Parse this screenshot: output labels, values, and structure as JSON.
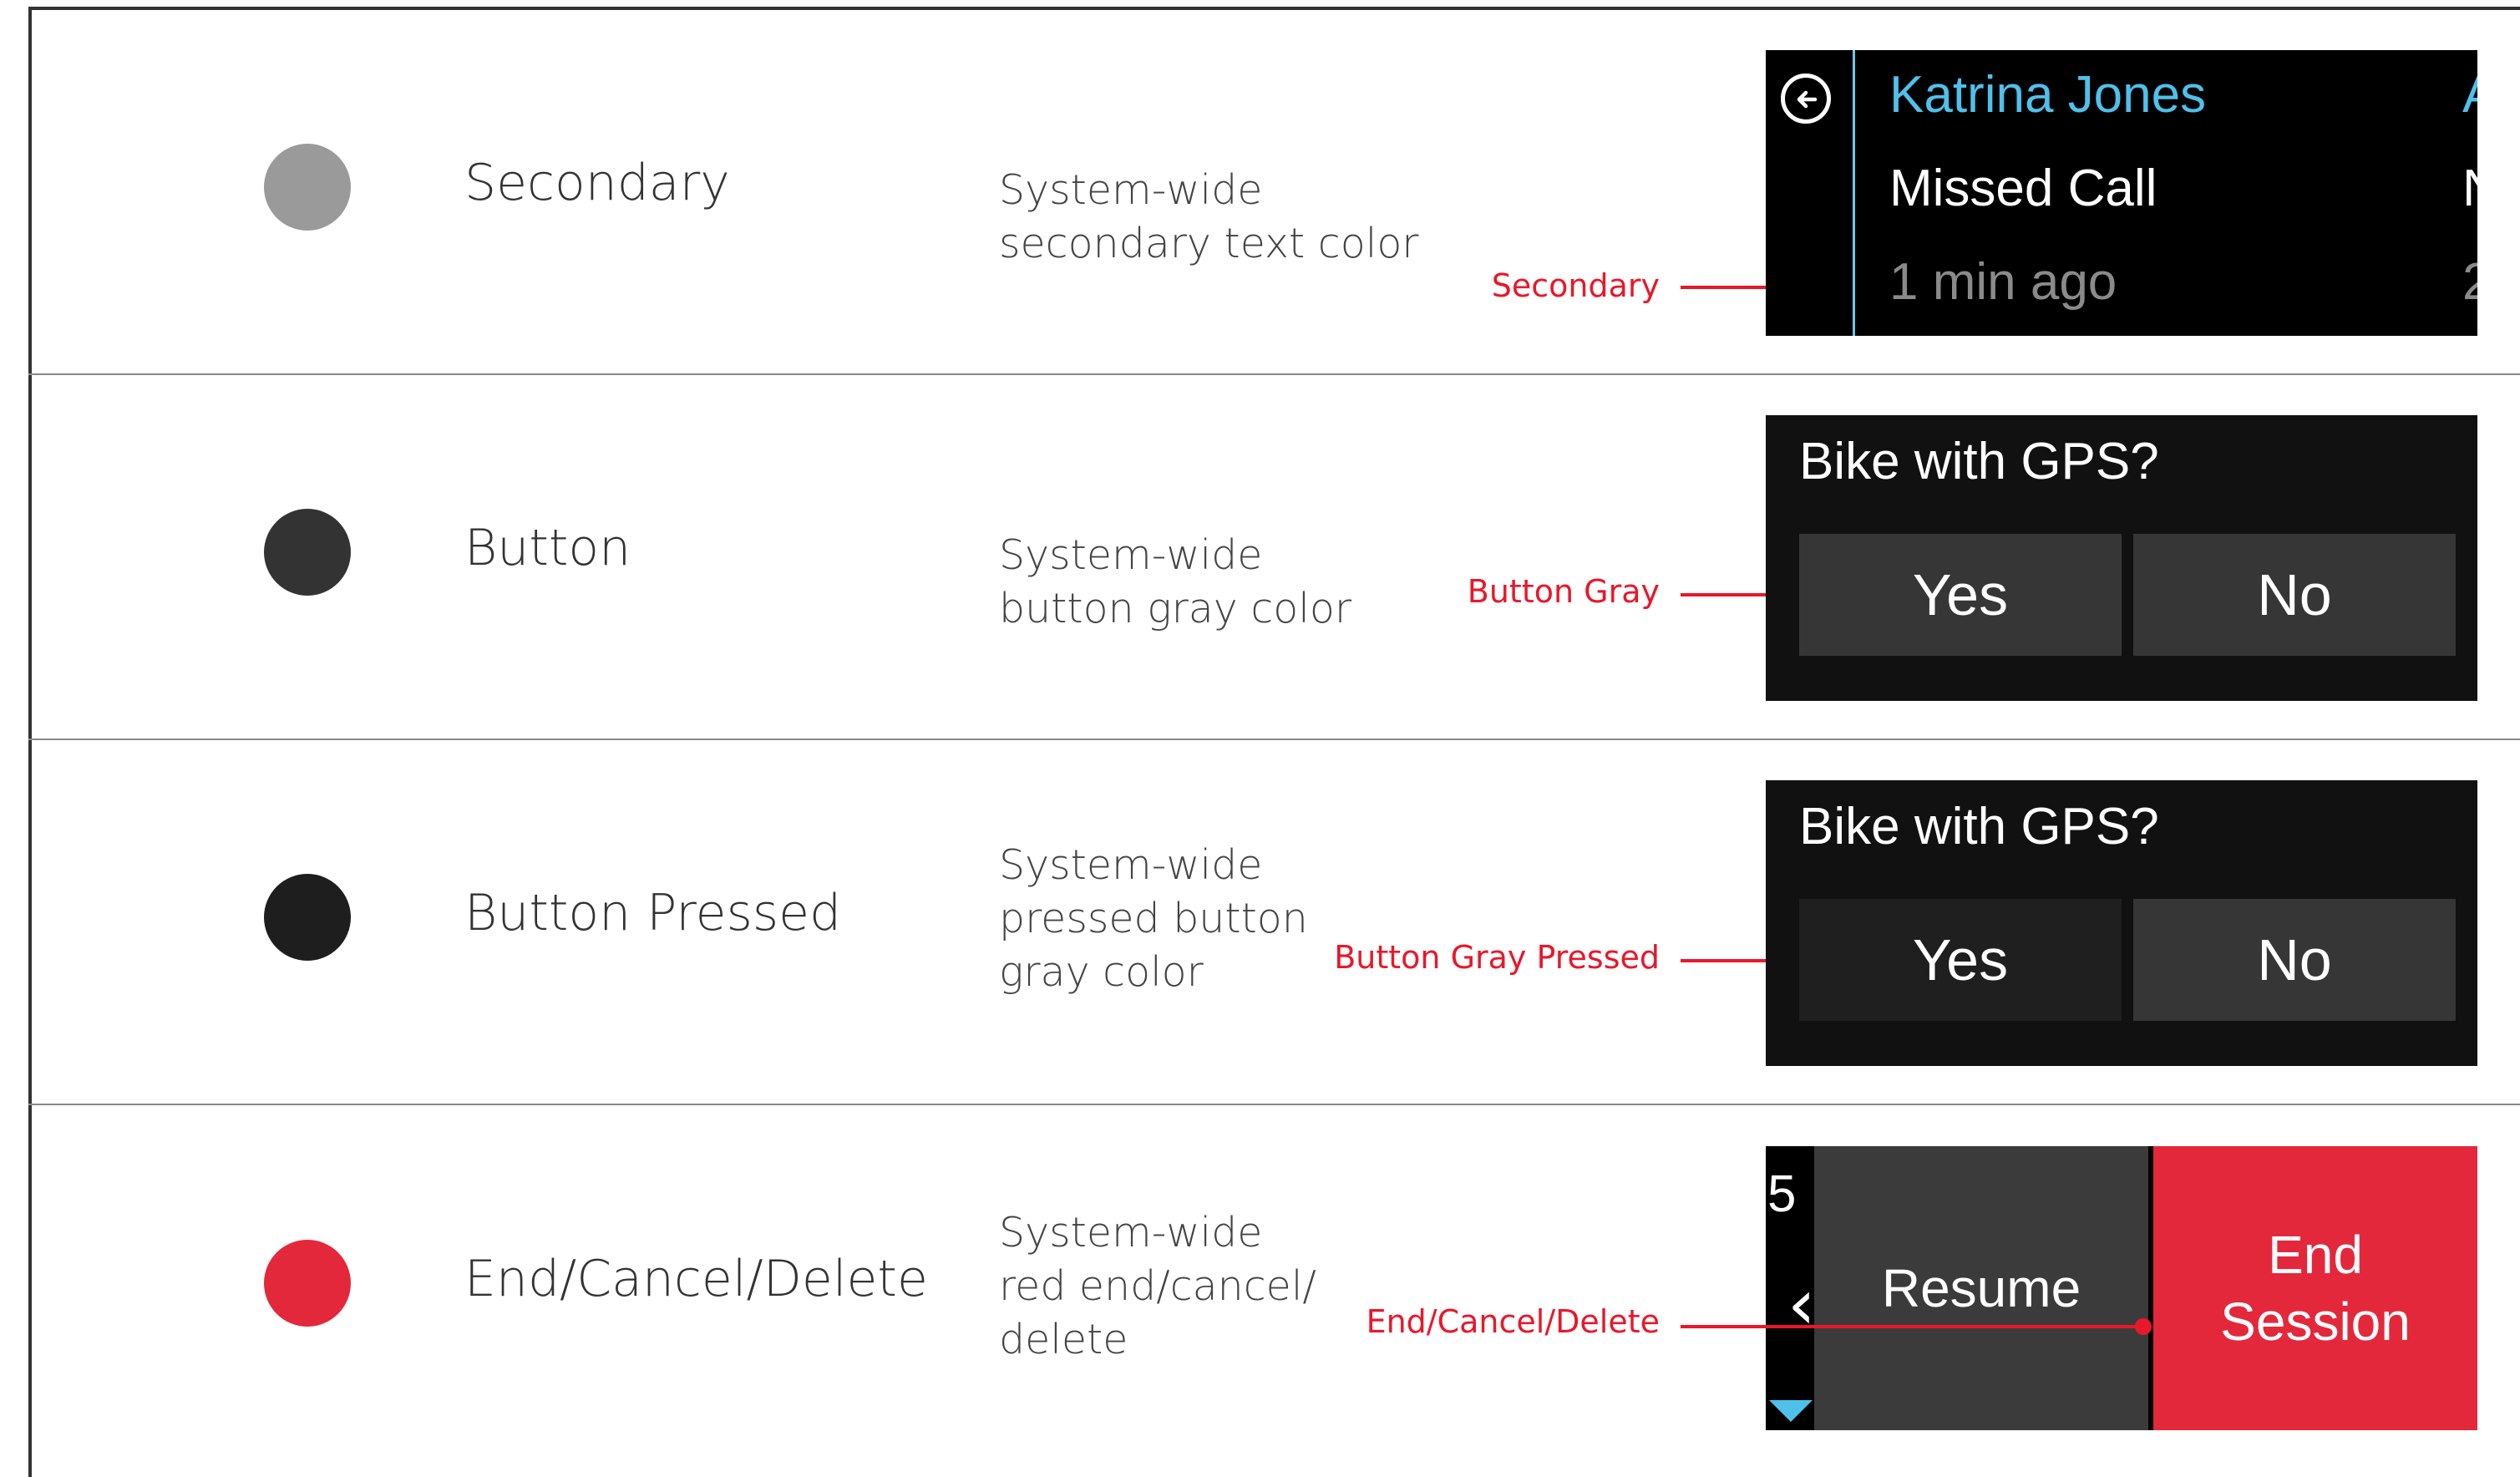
{
  "rows": [
    {
      "name": "Secondary",
      "swatch_color": "#9a9a9a",
      "description": [
        "System-wide",
        "secondary text color"
      ],
      "annotation": "Secondary"
    },
    {
      "name": "Button",
      "swatch_color": "#333333",
      "description": [
        "System-wide",
        "button gray color"
      ],
      "annotation": "Button Gray"
    },
    {
      "name": "Button Pressed",
      "swatch_color": "#1e1e1e",
      "description": [
        "System-wide",
        "pressed button",
        "gray color"
      ],
      "annotation": "Button Gray Pressed"
    },
    {
      "name": "End/Cancel/Delete",
      "swatch_color": "#e4283b",
      "description": [
        "System-wide",
        "red end/cancel/",
        "delete"
      ],
      "annotation": "End/Cancel/Delete"
    }
  ],
  "secondary_mock": {
    "name": "Katrina Jones",
    "status": "Missed Call",
    "time": "1 min ago",
    "peek_name": "A",
    "peek_status": "N",
    "peek_time": "2",
    "back_icon": "back-arrow-icon"
  },
  "gps_mock": {
    "title": "Bike with GPS?",
    "yes_label": "Yes",
    "no_label": "No",
    "button_color": "#363636",
    "button_pressed_color": "#1f1f1f"
  },
  "end_mock": {
    "number": "5",
    "resume_label": "Resume",
    "end_label_line1": "End",
    "end_label_line2": "Session",
    "chevron_icon": "chevron-left-icon",
    "down_icon": "triangle-down-icon"
  },
  "colors": {
    "annotation_red": "#e8182a",
    "accent_blue": "#4fc0ea"
  }
}
